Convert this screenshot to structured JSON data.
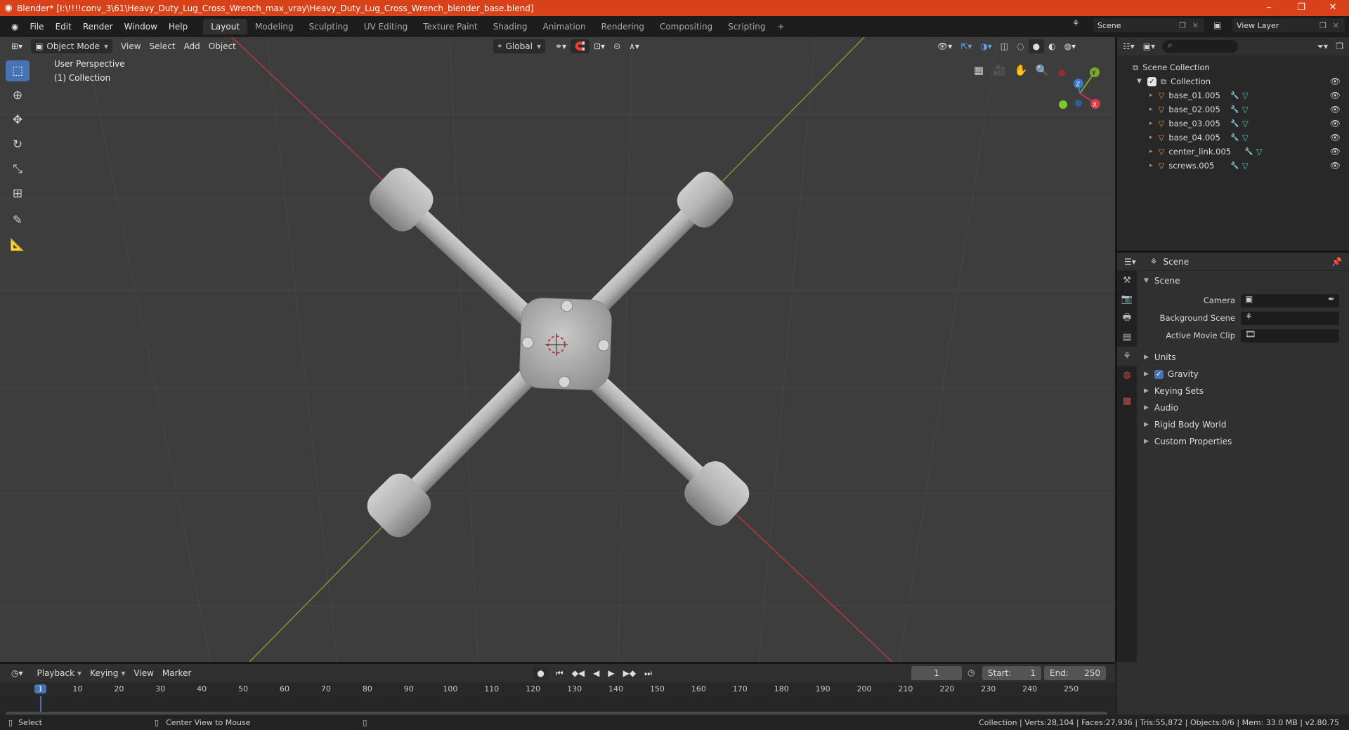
{
  "window": {
    "title": "Blender* [I:\\!!!!conv_3\\61\\Heavy_Duty_Lug_Cross_Wrench_max_vray\\Heavy_Duty_Lug_Cross_Wrench_blender_base.blend]",
    "controls": {
      "minimize": "–",
      "maximize": "❐",
      "close": "✕"
    }
  },
  "menu": [
    "File",
    "Edit",
    "Render",
    "Window",
    "Help"
  ],
  "workspace_tabs": [
    "Layout",
    "Modeling",
    "Sculpting",
    "UV Editing",
    "Texture Paint",
    "Shading",
    "Animation",
    "Rendering",
    "Compositing",
    "Scripting"
  ],
  "active_tab": "Layout",
  "scene_selector": {
    "value": "Scene"
  },
  "view_layer_selector": {
    "value": "View Layer"
  },
  "viewport": {
    "mode": "Object Mode",
    "menus": [
      "View",
      "Select",
      "Add",
      "Object"
    ],
    "orientation": "Global",
    "overlay_line1": "User Perspective",
    "overlay_line2": "(1) Collection",
    "gizmo": {
      "x": "X",
      "y": "Y",
      "z": "Z"
    }
  },
  "outliner": {
    "root": "Scene Collection",
    "collection": "Collection",
    "objects": [
      "base_01.005",
      "base_02.005",
      "base_03.005",
      "base_04.005",
      "center_link.005",
      "screws.005"
    ]
  },
  "properties": {
    "header": "Scene",
    "section": "Scene",
    "fields": [
      {
        "label": "Camera"
      },
      {
        "label": "Background Scene"
      },
      {
        "label": "Active Movie Clip"
      }
    ],
    "subsections": [
      "Units",
      "Gravity",
      "Keying Sets",
      "Audio",
      "Rigid Body World",
      "Custom Properties"
    ],
    "gravity_checked": true
  },
  "timeline": {
    "menus": [
      "Playback",
      "Keying",
      "View",
      "Marker"
    ],
    "current_frame": "1",
    "start_label": "Start:",
    "start": "1",
    "end_label": "End:",
    "end": "250",
    "ticks": [
      "1",
      "10",
      "20",
      "30",
      "40",
      "50",
      "60",
      "70",
      "80",
      "90",
      "100",
      "110",
      "120",
      "130",
      "140",
      "150",
      "160",
      "170",
      "180",
      "190",
      "200",
      "210",
      "220",
      "230",
      "240",
      "250"
    ]
  },
  "statusbar": {
    "left1": "Select",
    "left2": "Center View to Mouse",
    "right": "Collection | Verts:28,104 | Faces:27,936 | Tris:55,872 | Objects:0/6 | Mem: 33.0 MB | v2.80.75"
  },
  "colors": {
    "accent": "#4772b3",
    "titlebar": "#d8421b",
    "x_axis": "#c8353f",
    "y_axis": "#7aa62a",
    "object_icon": "#e08a3c"
  }
}
